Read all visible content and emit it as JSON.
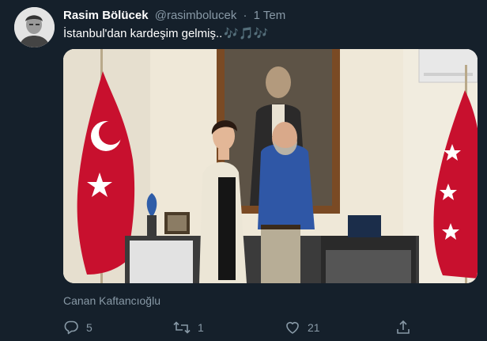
{
  "tweet": {
    "display_name": "Rasim Bölücek",
    "handle": "@rasimbolucek",
    "separator": "·",
    "time": "1 Tem",
    "text": "İstanbul'dan kardeşim gelmiş..",
    "emoji": "🎶🎵🎶",
    "photo_caption": "Canan Kaftancıoğlu",
    "reply_count": "5",
    "retweet_count": "1",
    "like_count": "21"
  },
  "colors": {
    "background": "#15202b",
    "secondary_text": "#8899a6",
    "accent": "#1da1f2",
    "flag_red": "#c8102e"
  },
  "icons": [
    "avatar",
    "reply-icon",
    "retweet-icon",
    "like-icon",
    "share-icon"
  ]
}
